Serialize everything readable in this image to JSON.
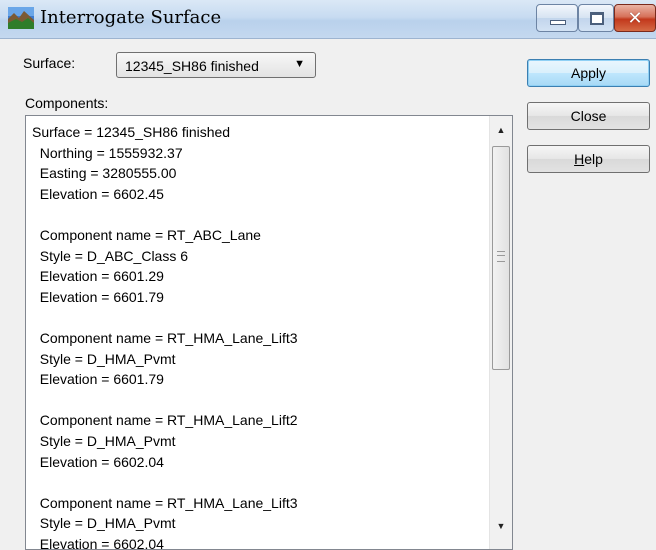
{
  "window": {
    "title": "Interrogate Surface",
    "close_glyph": "✕"
  },
  "surface": {
    "label": "Surface:",
    "selected": "12345_SH86 finished"
  },
  "components_label": "Components:",
  "components_lines": [
    "Surface = 12345_SH86 finished",
    "  Northing = 1555932.37",
    "  Easting = 3280555.00",
    "  Elevation = 6602.45",
    "",
    "  Component name = RT_ABC_Lane",
    "  Style = D_ABC_Class 6",
    "  Elevation = 6601.29",
    "  Elevation = 6601.79",
    "",
    "  Component name = RT_HMA_Lane_Lift3",
    "  Style = D_HMA_Pvmt",
    "  Elevation = 6601.79",
    "",
    "  Component name = RT_HMA_Lane_Lift2",
    "  Style = D_HMA_Pvmt",
    "  Elevation = 6602.04",
    "",
    "  Component name = RT_HMA_Lane_Lift3",
    "  Style = D_HMA_Pvmt",
    "  Elevation = 6602.04"
  ],
  "buttons": {
    "apply": "Apply",
    "close": "Close",
    "help_mnemonic": "H",
    "help_rest": "elp"
  },
  "icons": {
    "app": "mountain-landscape-icon",
    "scroll_up": "▲",
    "scroll_down": "▼",
    "dropdown": "▼"
  }
}
